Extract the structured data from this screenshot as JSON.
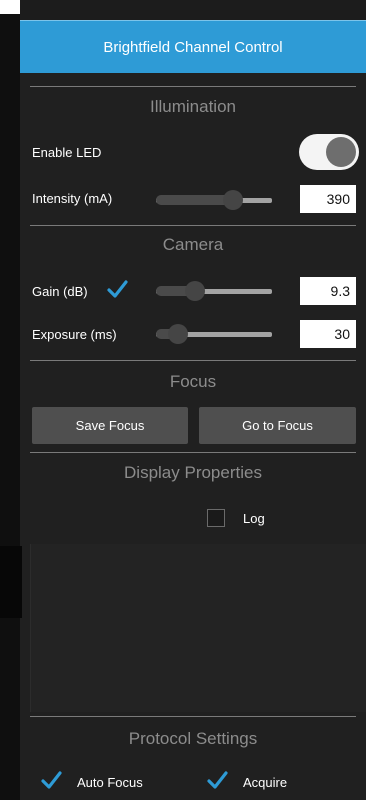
{
  "header": {
    "title": "Brightfield Channel Control"
  },
  "illumination": {
    "title": "Illumination",
    "enable_led_label": "Enable LED",
    "enable_led_on": true,
    "intensity_label": "Intensity (mA)",
    "intensity_value": "390",
    "intensity_slider_fraction": 0.7
  },
  "camera": {
    "title": "Camera",
    "gain_label": "Gain (dB)",
    "gain_auto_checked": true,
    "gain_value": "9.3",
    "gain_slider_fraction": 0.3,
    "exposure_label": "Exposure (ms)",
    "exposure_value": "30",
    "exposure_slider_fraction": 0.12
  },
  "focus": {
    "title": "Focus",
    "save_label": "Save Focus",
    "goto_label": "Go to Focus"
  },
  "display": {
    "title": "Display Properties",
    "log_label": "Log",
    "log_checked": false
  },
  "protocol": {
    "title": "Protocol Settings",
    "auto_focus_label": "Auto Focus",
    "auto_focus_checked": true,
    "acquire_label": "Acquire",
    "acquire_checked": true
  },
  "colors": {
    "accent": "#2e9bd6",
    "check": "#2e9bd6"
  }
}
